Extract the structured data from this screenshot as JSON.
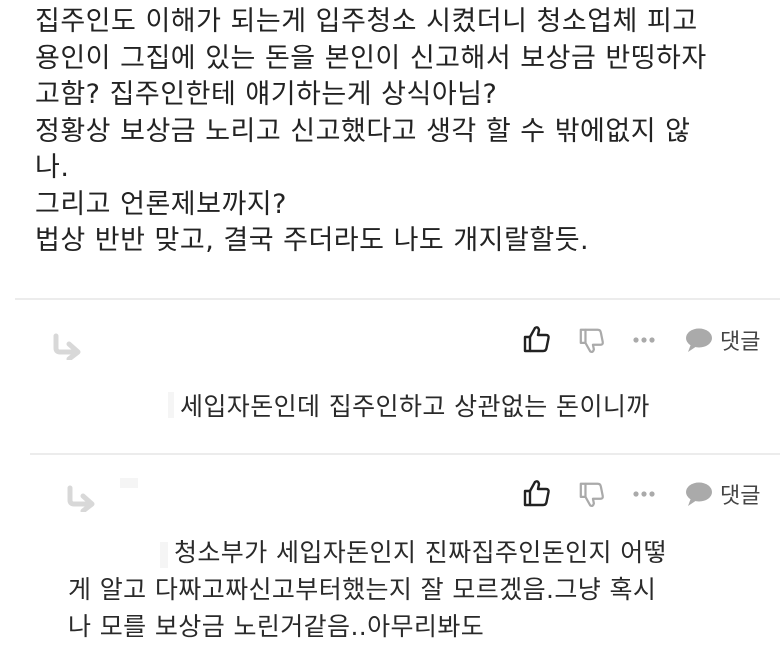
{
  "post": {
    "lines": [
      "집주인도 이해가 되는게 입주청소 시켰더니 청소업체 피고",
      "용인이 그집에 있는 돈을 본인이 신고해서 보상금 반띵하자",
      "고함? 집주인한테 얘기하는게 상식아님?",
      "정황상 보상금 노리고 신고했다고 생각 할 수 밖에없지 않",
      "나.",
      "그리고 언론제보까지?",
      "법상 반반 맞고, 결국 주더라도 나도 개지랄할듯."
    ]
  },
  "actions": {
    "reply_label": "댓글",
    "icons": [
      "reply-arrow-icon",
      "thumbs-up-icon",
      "thumbs-down-icon",
      "more-icon",
      "speech-bubble-icon"
    ]
  },
  "comments": [
    {
      "lines": [
        "세입자돈인데 집주인하고 상관없는 돈이니까"
      ]
    },
    {
      "lines": [
        "청소부가 세입자돈인지 진짜집주인돈인지 어떻",
        "게 알고 다짜고짜신고부터했는지 잘 모르겠음.그냥 혹시",
        "나 모를 보상금 노린거같음..아무리봐도"
      ]
    }
  ]
}
